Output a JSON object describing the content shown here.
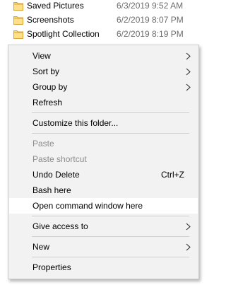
{
  "files": [
    {
      "name": "Saved Pictures",
      "date": "6/3/2019 9:52 AM"
    },
    {
      "name": "Screenshots",
      "date": "6/2/2019 8:07 PM"
    },
    {
      "name": "Spotlight Collection",
      "date": "6/2/2019 8:19 PM"
    }
  ],
  "menu": {
    "view": "View",
    "sort_by": "Sort by",
    "group_by": "Group by",
    "refresh": "Refresh",
    "customize": "Customize this folder...",
    "paste": "Paste",
    "paste_shortcut": "Paste shortcut",
    "undo_delete": "Undo Delete",
    "undo_delete_shortcut": "Ctrl+Z",
    "bash_here": "Bash here",
    "open_cmd": "Open command window here",
    "give_access": "Give access to",
    "new": "New",
    "properties": "Properties"
  },
  "colors": {
    "menu_background": "#f2f2f2",
    "highlight": "#ffffff",
    "folder": "#f8d775",
    "disabled_text": "#8c8c8c"
  }
}
